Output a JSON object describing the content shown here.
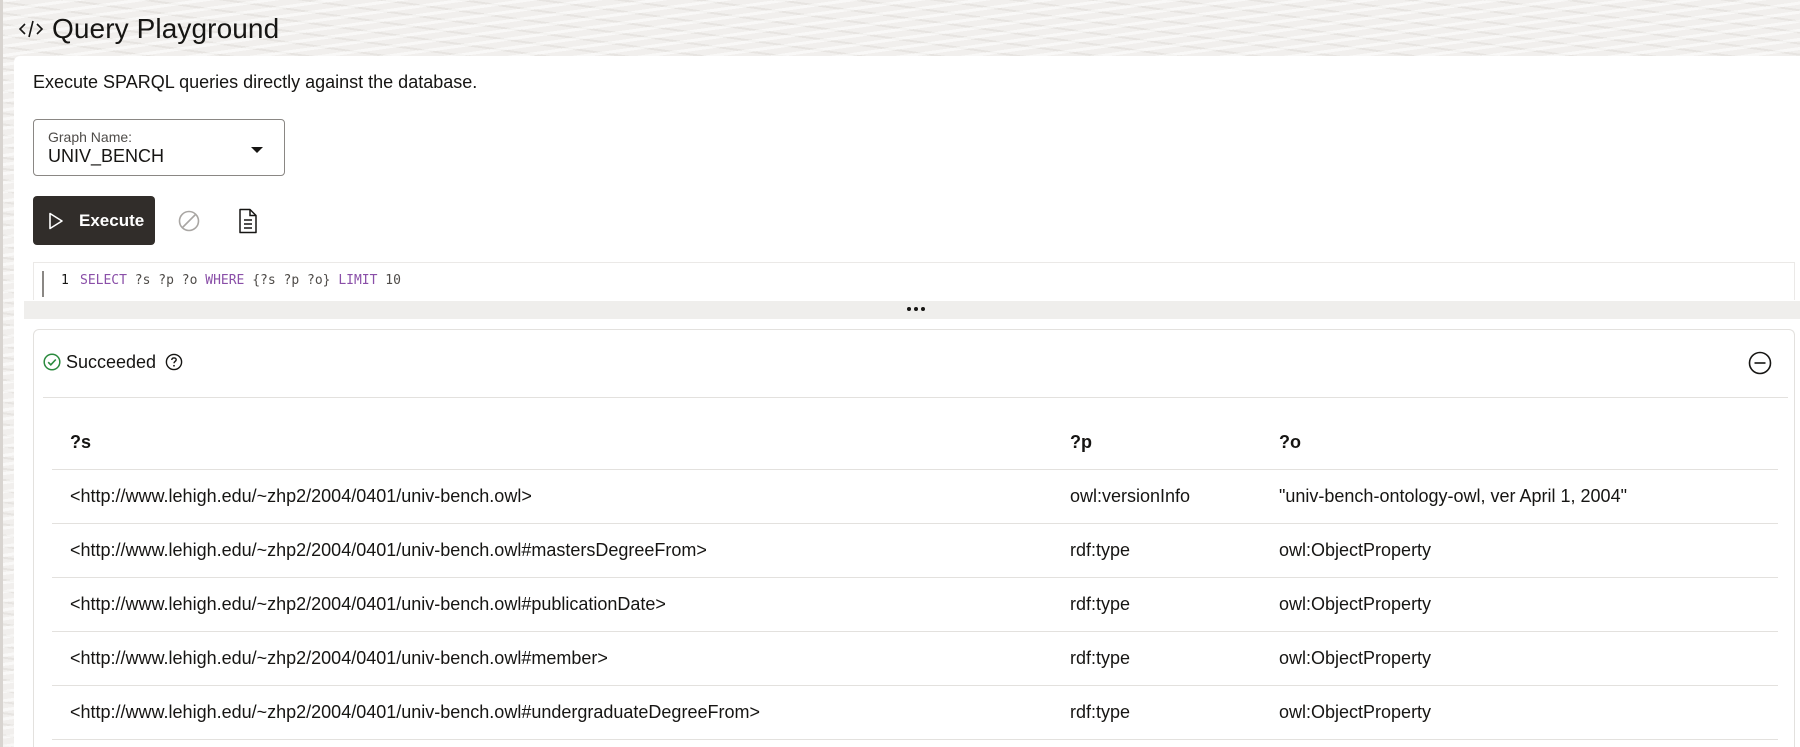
{
  "header": {
    "title": "Query Playground",
    "icon": "code-icon"
  },
  "description": "Execute SPARQL queries directly against the database.",
  "graph_select": {
    "label": "Graph Name:",
    "value": "UNIV_BENCH"
  },
  "toolbar": {
    "execute_label": "Execute",
    "cancel_icon": "cancel-icon",
    "document_icon": "document-icon"
  },
  "editor": {
    "line_number": "1",
    "tokens": [
      {
        "text": "SELECT",
        "kw": true
      },
      {
        "text": " ?s ?p ?o ",
        "kw": false
      },
      {
        "text": "WHERE",
        "kw": true
      },
      {
        "text": " {?s ?p ?o} ",
        "kw": false
      },
      {
        "text": "LIMIT",
        "kw": true
      },
      {
        "text": " 10",
        "kw": false
      }
    ]
  },
  "result": {
    "status": "Succeeded",
    "colors": {
      "success": "#2b8a3e",
      "execute_bg": "#312d2a",
      "keyword": "#8a4fa8"
    },
    "columns": [
      "?s",
      "?p",
      "?o"
    ],
    "rows": [
      [
        "<http://www.lehigh.edu/~zhp2/2004/0401/univ-bench.owl>",
        "owl:versionInfo",
        "\"univ-bench-ontology-owl, ver April 1, 2004\""
      ],
      [
        "<http://www.lehigh.edu/~zhp2/2004/0401/univ-bench.owl#mastersDegreeFrom>",
        "rdf:type",
        "owl:ObjectProperty"
      ],
      [
        "<http://www.lehigh.edu/~zhp2/2004/0401/univ-bench.owl#publicationDate>",
        "rdf:type",
        "owl:ObjectProperty"
      ],
      [
        "<http://www.lehigh.edu/~zhp2/2004/0401/univ-bench.owl#member>",
        "rdf:type",
        "owl:ObjectProperty"
      ],
      [
        "<http://www.lehigh.edu/~zhp2/2004/0401/univ-bench.owl#undergraduateDegreeFrom>",
        "rdf:type",
        "owl:ObjectProperty"
      ]
    ]
  }
}
